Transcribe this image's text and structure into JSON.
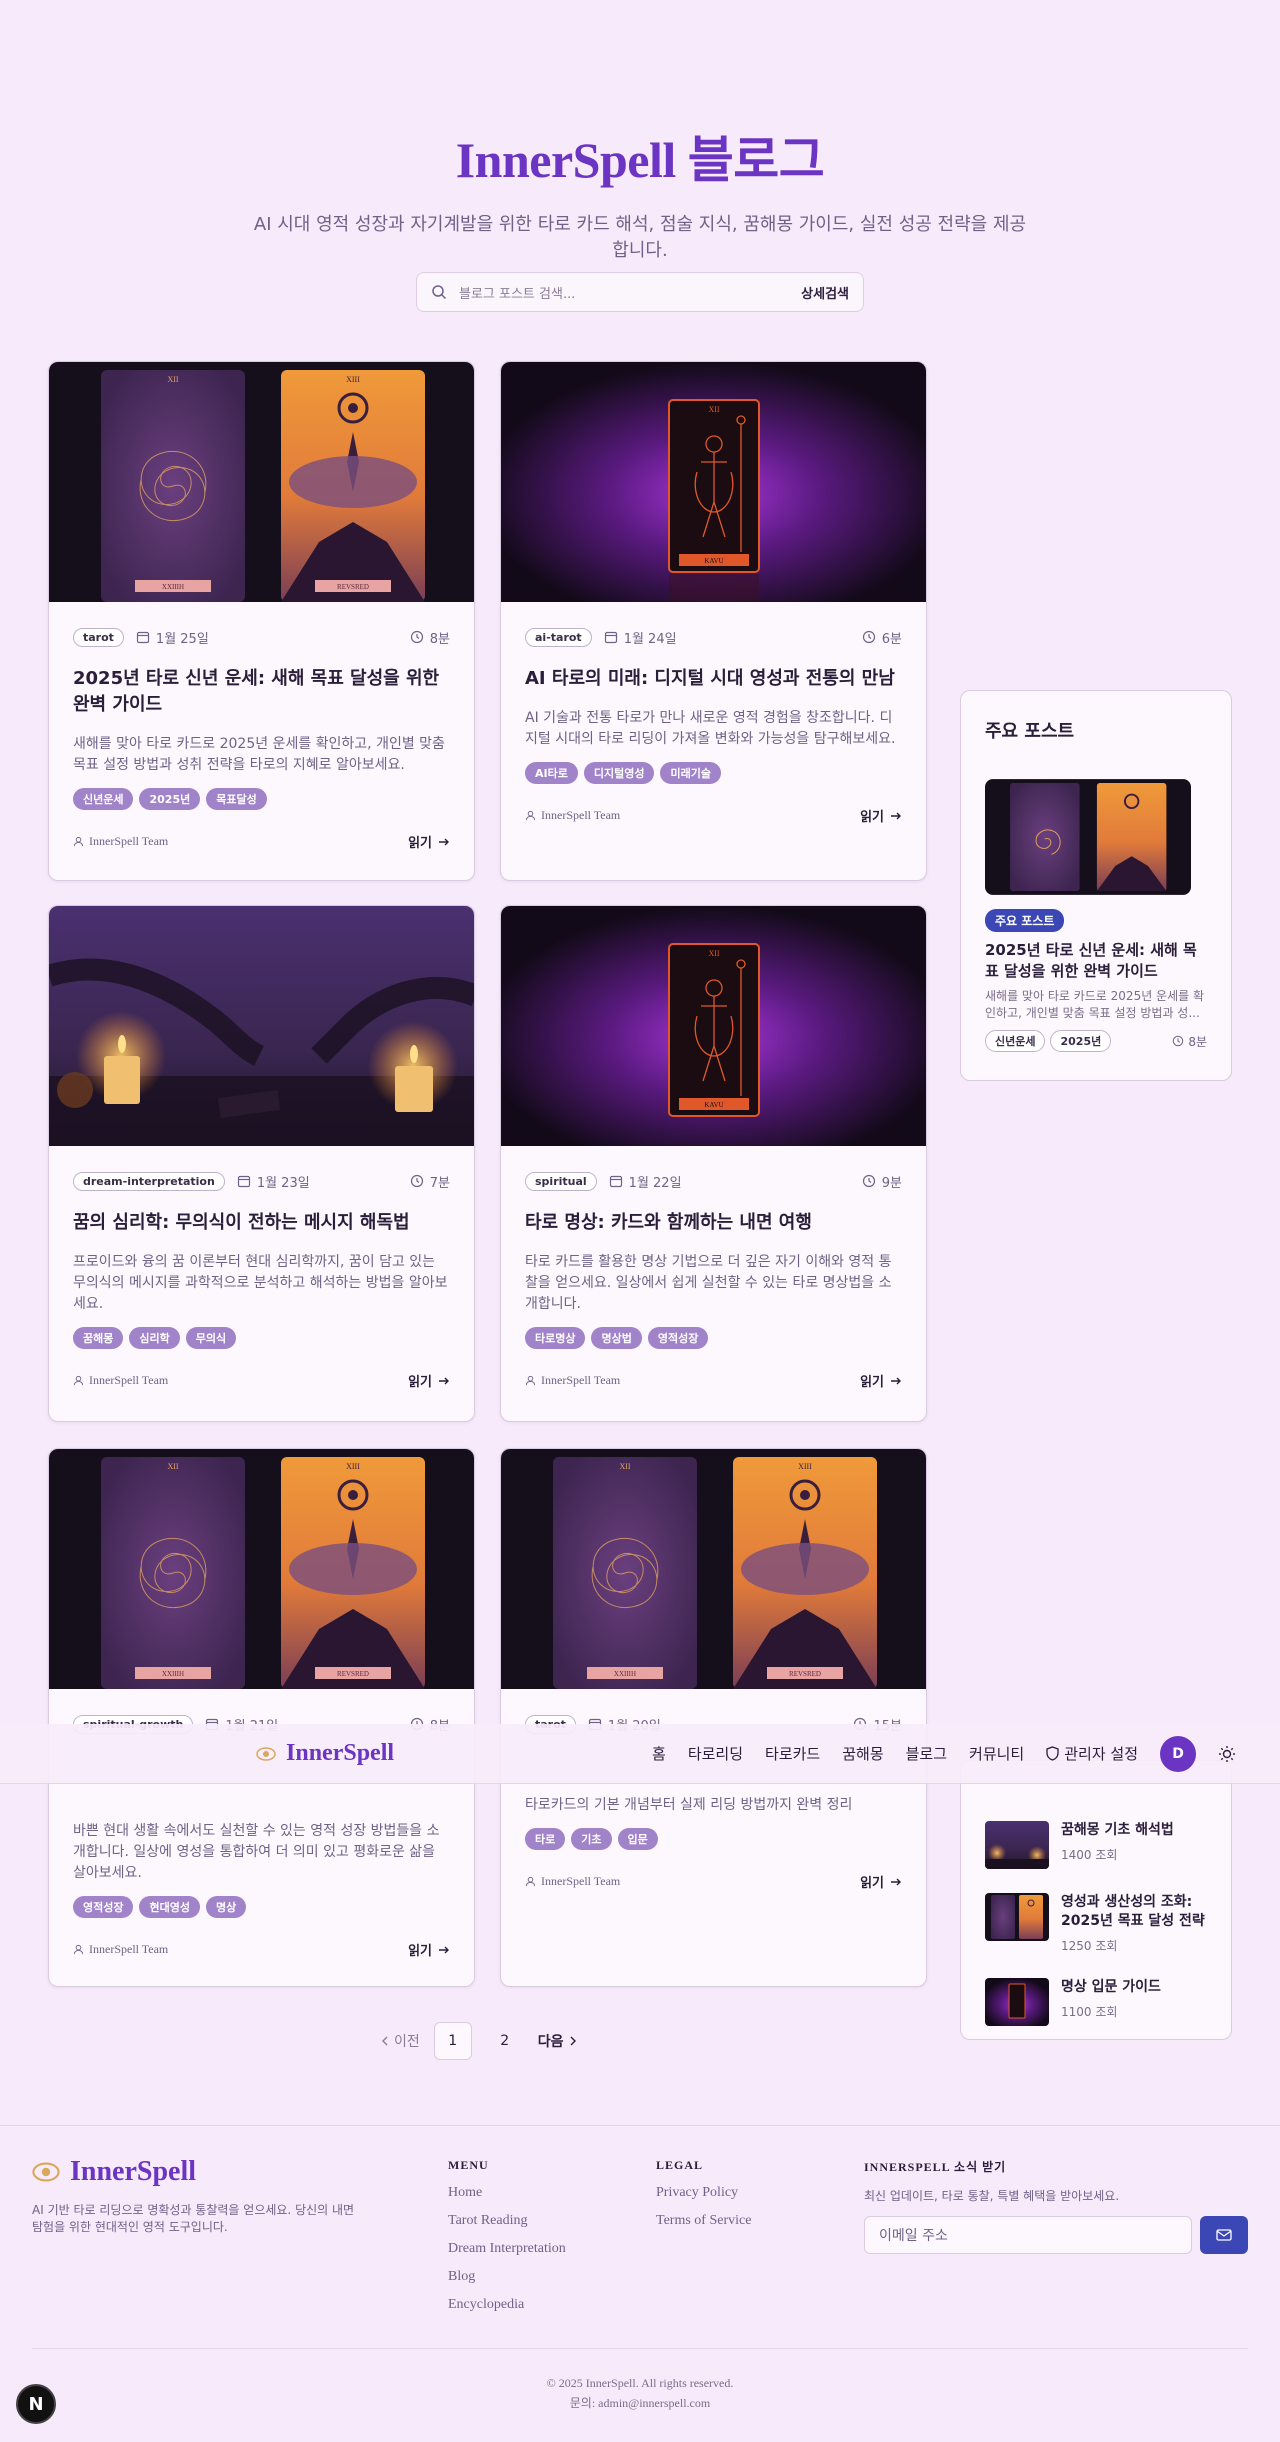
{
  "hero": {
    "title": "InnerSpell 블로그",
    "subtitle": "AI 시대 영적 성장과 자기계발을 위한 타로 카드 해석, 점술 지식, 꿈해몽 가이드, 실전 성공 전략을 제공합니다."
  },
  "search": {
    "placeholder": "블로그 포스트 검색...",
    "advanced": "상세검색"
  },
  "read_label": "읽기",
  "posts": [
    {
      "category": "tarot",
      "date": "1월 25일",
      "time": "8분",
      "title": "2025년 타로 신년 운세: 새해 목표 달성을 위한 완벽 가이드",
      "excerpt": "새해를 맞아 타로 카드로 2025년 운세를 확인하고, 개인별 맞춤 목표 설정 방법과 성취 전략을 타로의 지혜로 알아보세요.",
      "tags": [
        "신년운세",
        "2025년",
        "목표달성"
      ],
      "author": "InnerSpell Team",
      "card_labels": [
        "XII",
        "XIII",
        "XXIIIH",
        "REVSRED"
      ]
    },
    {
      "category": "ai-tarot",
      "date": "1월 24일",
      "time": "6분",
      "title": "AI 타로의 미래: 디지털 시대 영성과 전통의 만남",
      "excerpt": "AI 기술과 전통 타로가 만나 새로운 영적 경험을 창조합니다. 디지털 시대의 타로 리딩이 가져올 변화와 가능성을 탐구해보세요.",
      "tags": [
        "AI타로",
        "디지털영성",
        "미래기술"
      ],
      "author": "InnerSpell Team",
      "card_labels": [
        "XII",
        "KAVU"
      ]
    },
    {
      "category": "dream-interpretation",
      "date": "1월 23일",
      "time": "7분",
      "title": "꿈의 심리학: 무의식이 전하는 메시지 해독법",
      "excerpt": "프로이드와 융의 꿈 이론부터 현대 심리학까지, 꿈이 담고 있는 무의식의 메시지를 과학적으로 분석하고 해석하는 방법을 알아보세요.",
      "tags": [
        "꿈해몽",
        "심리학",
        "무의식"
      ],
      "author": "InnerSpell Team"
    },
    {
      "category": "spiritual",
      "date": "1월 22일",
      "time": "9분",
      "title": "타로 명상: 카드와 함께하는 내면 여행",
      "excerpt": "타로 카드를 활용한 명상 기법으로 더 깊은 자기 이해와 영적 통찰을 얻으세요. 일상에서 쉽게 실천할 수 있는 타로 명상법을 소개합니다.",
      "tags": [
        "타로명상",
        "명상법",
        "영적성장"
      ],
      "author": "InnerSpell Team",
      "card_labels": [
        "XII",
        "KAVU"
      ]
    },
    {
      "category": "spiritual-growth",
      "date": "1월 21일",
      "time": "8분",
      "title": "",
      "excerpt": "바쁜 현대 생활 속에서도 실천할 수 있는 영적 성장 방법들을 소개합니다. 일상에 영성을 통합하여 더 의미 있고 평화로운 삶을 살아보세요.",
      "tags": [
        "영적성장",
        "현대영성",
        "명상"
      ],
      "author": "InnerSpell Team",
      "card_labels": [
        "XII",
        "XIII",
        "XXIIIH",
        "REVSRED"
      ]
    },
    {
      "category": "tarot",
      "date": "1월 20일",
      "time": "15분",
      "title": "",
      "excerpt": "타로카드의 기본 개념부터 실제 리딩 방법까지 완벽 정리",
      "tags": [
        "타로",
        "기초",
        "입문"
      ],
      "author": "InnerSpell Team",
      "card_labels": [
        "XII",
        "XIII",
        "XXIIIH",
        "REVSRED"
      ]
    }
  ],
  "featured": {
    "heading": "주요 포스트",
    "badge": "주요 포스트",
    "title": "2025년 타로 신년 운세: 새해 목표 달성을 위한 완벽 가이드",
    "excerpt": "새해를 맞아 타로 카드로 2025년 운세를 확인하고, 개인별 맞춤 목표 설정 방법과 성...",
    "tags": [
      "신년운세",
      "2025년"
    ],
    "time": "8분"
  },
  "popular": [
    {
      "title": "꿈해몽 기초 해석법",
      "views": "1400 조회"
    },
    {
      "title": "영성과 생산성의 조화: 2025년 목표 달성 전략",
      "views": "1250 조회"
    },
    {
      "title": "명상 입문 가이드",
      "views": "1100 조회"
    }
  ],
  "nav": {
    "brand": "InnerSpell",
    "links": [
      "홈",
      "타로리딩",
      "타로카드",
      "꿈해몽",
      "블로그",
      "커뮤니티"
    ],
    "admin": "관리자 설정",
    "avatar": "D"
  },
  "pagination": {
    "prev": "이전",
    "pages": [
      "1",
      "2"
    ],
    "next": "다음"
  },
  "footer": {
    "brand": "InnerSpell",
    "desc": "AI 기반 타로 리딩으로 명확성과 통찰력을 얻으세요. 당신의 내면 탐험을 위한 현대적인 영적 도구입니다.",
    "menu_head": "MENU",
    "menu": [
      "Home",
      "Tarot Reading",
      "Dream Interpretation",
      "Blog",
      "Encyclopedia"
    ],
    "legal_head": "LEGAL",
    "legal": [
      "Privacy Policy",
      "Terms of Service"
    ],
    "news_head": "INNERSPELL 소식 받기",
    "news_desc": "최신 업데이트, 타로 통찰, 특별 혜택을 받아보세요.",
    "email_placeholder": "이메일 주소",
    "copyright": "© 2025 InnerSpell. All rights reserved.",
    "contact": "문의: admin@innerspell.com"
  },
  "colors": {
    "brand": "#6b34c2",
    "tag": "#a083c9",
    "accent": "#3a47b5",
    "bg": "#f7eafa"
  },
  "icons": [
    "search-icon",
    "calendar-icon",
    "clock-icon",
    "user-icon",
    "arrow-right-icon",
    "shield-icon",
    "sun-icon",
    "mail-icon",
    "eye-logo-icon",
    "chevron-left-icon",
    "chevron-right-icon"
  ]
}
